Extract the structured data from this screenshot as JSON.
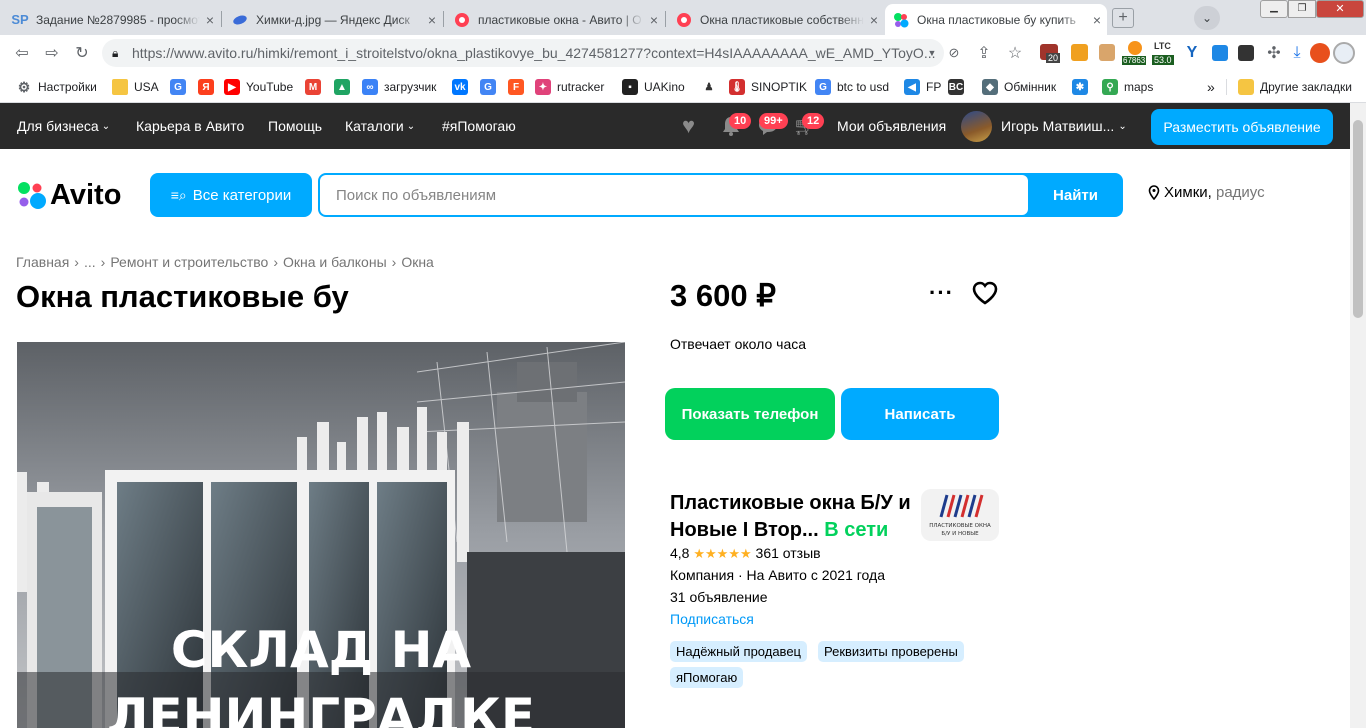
{
  "browser": {
    "tabs": [
      {
        "favicon_text": "SP",
        "favicon_color": "#4c8bd6",
        "title": "Задание №2879985 - просмот",
        "close": "×"
      },
      {
        "favicon_text": "",
        "favicon_color": "#3a6bd8",
        "title": "Химки-д.jpg — Яндекс Диск",
        "close": "×"
      },
      {
        "favicon_text": "",
        "favicon_color": "#ff4053",
        "title": "пластиковые окна - Авито | О",
        "close": "×"
      },
      {
        "favicon_text": "",
        "favicon_color": "#ff4053",
        "title": "Окна пластиковые собственн",
        "close": "×"
      },
      {
        "favicon_text": "",
        "favicon_color": "#04e061",
        "title": "Окна пластиковые бу купить",
        "close": "×"
      }
    ],
    "url_main": "https://www.avito.ru",
    "url_rest": "/himki/remont_i_stroitelstvo/okna_plastikovye_bu_4274581277?context=H4sIAAAAAAAA_wE_AMD_YToyO...",
    "ext_badges": {
      "a": "20",
      "b": "67863",
      "c": "LTC",
      "d": "53.0"
    },
    "bookmarks": [
      {
        "label": "Настройки",
        "icon_color": "#5f6368"
      },
      {
        "label": "USA",
        "icon_color": "#f5c542"
      },
      {
        "label": "",
        "icon_color": "#4285f4"
      },
      {
        "label": "",
        "icon_color": "#fc3f1d"
      },
      {
        "label": "YouTube",
        "icon_color": "#ff0000"
      },
      {
        "label": "",
        "icon_color": "#ea4335"
      },
      {
        "label": "",
        "icon_color": "#1fa463"
      },
      {
        "label": "загрузчик",
        "icon_color": "#3b82f6"
      },
      {
        "label": "",
        "icon_color": "#0077ff"
      },
      {
        "label": "",
        "icon_color": "#4285f4"
      },
      {
        "label": "",
        "icon_color": "#ff5722"
      },
      {
        "label": "rutracker",
        "icon_color": "#e0427a"
      },
      {
        "label": "UAKino",
        "icon_color": "#222222"
      },
      {
        "label": "",
        "icon_color": "#333333"
      },
      {
        "label": "SINOPTIK",
        "icon_color": "#d32f2f"
      },
      {
        "label": "btc to usd",
        "icon_color": "#4285f4"
      },
      {
        "label": "FP",
        "icon_color": "#1e88e5"
      },
      {
        "label": "",
        "icon_color": "#333333"
      },
      {
        "label": "Обмінник",
        "icon_color": "#546e7a"
      },
      {
        "label": "",
        "icon_color": "#1e88e5"
      },
      {
        "label": "maps",
        "icon_color": "#34a853"
      }
    ],
    "bookmarks_more": "»",
    "other_bookmarks": "Другие закладки"
  },
  "avito_nav": {
    "for_business": "Для бизнеса",
    "career": "Карьера в Авито",
    "help": "Помощь",
    "catalogs": "Каталоги",
    "yapomogayu": "#яПомогаю",
    "notif_badge": "10",
    "msg_badge": "99+",
    "cart_badge": "12",
    "my_ads": "Мои объявления",
    "user_name": "Игорь Матвииш...",
    "post_ad": "Разместить объявление"
  },
  "search": {
    "logo_text": "Avito",
    "categories_label": "Все категории",
    "placeholder": "Поиск по объявлениям",
    "find_label": "Найти",
    "location_city": "Химки,",
    "location_radius": "радиус"
  },
  "breadcrumbs": [
    "Главная",
    "...",
    "Ремонт и строительство",
    "Окна и балконы",
    "Окна"
  ],
  "breadcrumb_sep": "›",
  "listing": {
    "title": "Окна пластиковые бу",
    "price": "3 600 ₽",
    "responds": "Отвечает около часа",
    "photo_caption_line1": "СКЛАД НА",
    "photo_caption_line2": "ЛЕНИНГРАДКЕ",
    "show_phone": "Показать телефон",
    "write": "Написать"
  },
  "seller": {
    "name": "Пластиковые окна Б/У и Новые I Втор...",
    "online": "В сети",
    "rating": "4,8",
    "stars": "★★★★★",
    "reviews": "361 отзыв",
    "type_since": "Компания · На Авито с 2021 года",
    "ads_count": "31 объявление",
    "subscribe": "Подписаться",
    "logo_text1": "ПЛАСТИКОВЫЕ ОКНА",
    "logo_text2": "Б/У И НОВЫЕ",
    "tags": [
      "Надёжный продавец",
      "Реквизиты проверены",
      "яПомогаю"
    ]
  },
  "colors": {
    "avito_blue": "#00aaff",
    "avito_green": "#02d15c",
    "topbar": "#2a2a2a",
    "badge_red": "#ff4053"
  }
}
